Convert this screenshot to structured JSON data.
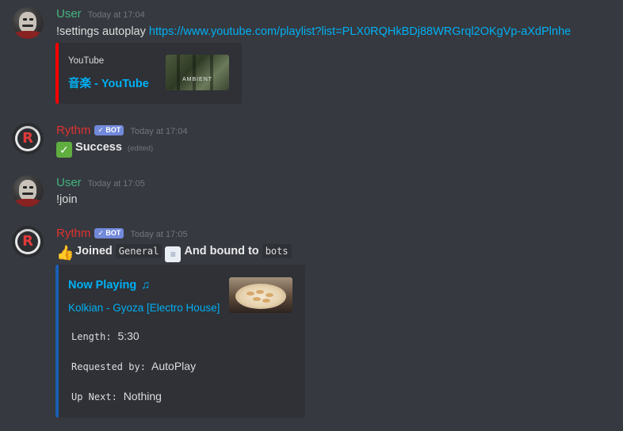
{
  "messages": [
    {
      "author": "User",
      "timestamp": "Today at 17:04",
      "command": "!settings autoplay",
      "link": "https://www.youtube.com/playlist?list=PLX0RQHkBDj88WRGrql2OKgVp-aXdPlnhe",
      "embed": {
        "provider": "YouTube",
        "title": "音楽 - YouTube",
        "thumb_text": "AMBIENT",
        "accent": "#ff0000"
      }
    },
    {
      "author": "Rythm",
      "badge": "✓ BOT",
      "timestamp": "Today at 17:04",
      "emoji": "check-mark",
      "text": "Success",
      "edited": "(edited)"
    },
    {
      "author": "User",
      "timestamp": "Today at 17:05",
      "text": "!join"
    },
    {
      "author": "Rythm",
      "badge": "✓ BOT",
      "timestamp": "Today at 17:05",
      "emoji": "thumbs-up",
      "joined_label": "Joined",
      "channel": "General",
      "emoji2": "page",
      "bound_label": "And bound to",
      "bound_channel": "bots",
      "embed": {
        "title": "Now Playing",
        "title_icon": "♫",
        "track": "Kolkian - Gyoza [Electro House]",
        "accent": "#1a5fb4",
        "fields": [
          {
            "label": "Length:",
            "value": "5:30"
          },
          {
            "label": "Requested by:",
            "value": "AutoPlay"
          },
          {
            "label": "Up Next:",
            "value": "Nothing"
          }
        ]
      }
    }
  ],
  "colors": {
    "background": "#36393f",
    "user_name": "#43b581",
    "bot_name": "#e03131",
    "link": "#00b0f4",
    "badge": "#7289da"
  }
}
